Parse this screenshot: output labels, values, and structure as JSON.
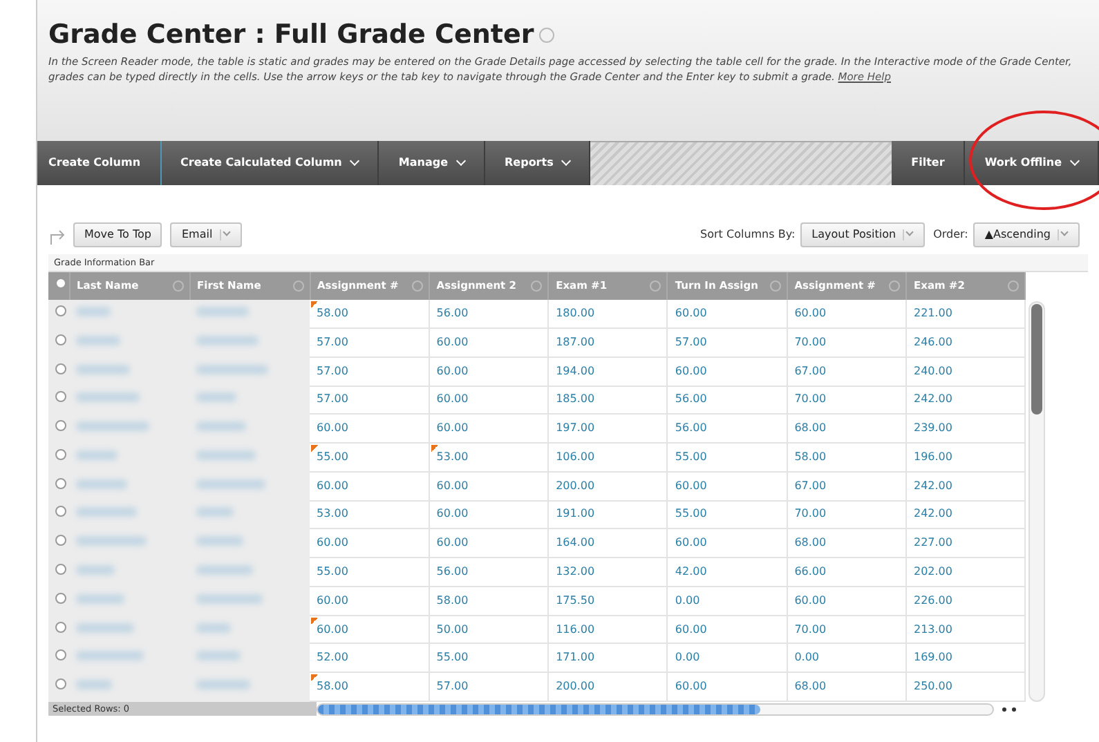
{
  "page": {
    "title": "Grade Center : Full Grade Center",
    "description": "In the Screen Reader mode, the table is static and grades may be entered on the Grade Details page accessed by selecting the table cell for the grade. In the Interactive mode of the Grade Center, grades can be typed directly in the cells. Use the arrow keys or the tab key to navigate through the Grade Center and the Enter key to submit a grade.",
    "help_link": "More Help"
  },
  "toolbar": {
    "items": [
      {
        "label": "Create Column",
        "dropdown": false
      },
      {
        "label": "Create Calculated Column",
        "dropdown": true
      },
      {
        "label": "Manage",
        "dropdown": true
      },
      {
        "label": "Reports",
        "dropdown": true
      }
    ],
    "right_items": [
      {
        "label": "Filter",
        "dropdown": false
      },
      {
        "label": "Work Offline",
        "dropdown": true
      }
    ]
  },
  "actions": [
    {
      "label": "Move To Top",
      "dropdown": false
    },
    {
      "label": "Email",
      "dropdown": true
    }
  ],
  "sort": {
    "label": "Sort Columns By:",
    "value": "Layout Position",
    "order_label": "Order:",
    "order_value": "▲Ascending"
  },
  "info_bar": "Grade Information Bar",
  "table": {
    "all_selected": false,
    "name_columns": [
      "Last Name",
      "First Name"
    ],
    "columns": [
      "Assignment #",
      "Assignment 2",
      "Exam #1",
      "Turn In Assign",
      "Assignment #",
      "Exam #2"
    ],
    "rows": [
      {
        "selected": false,
        "cells": [
          {
            "value": "58.00",
            "flagged": true
          },
          {
            "value": "56.00",
            "flagged": false
          },
          {
            "value": "180.00",
            "flagged": false
          },
          {
            "value": "60.00",
            "flagged": false
          },
          {
            "value": "60.00",
            "flagged": false
          },
          {
            "value": "221.00",
            "flagged": false
          }
        ]
      },
      {
        "selected": false,
        "cells": [
          {
            "value": "57.00",
            "flagged": false
          },
          {
            "value": "60.00",
            "flagged": false
          },
          {
            "value": "187.00",
            "flagged": false
          },
          {
            "value": "57.00",
            "flagged": false
          },
          {
            "value": "70.00",
            "flagged": false
          },
          {
            "value": "246.00",
            "flagged": false
          }
        ]
      },
      {
        "selected": false,
        "cells": [
          {
            "value": "57.00",
            "flagged": false
          },
          {
            "value": "60.00",
            "flagged": false
          },
          {
            "value": "194.00",
            "flagged": false
          },
          {
            "value": "60.00",
            "flagged": false
          },
          {
            "value": "67.00",
            "flagged": false
          },
          {
            "value": "240.00",
            "flagged": false
          }
        ]
      },
      {
        "selected": false,
        "cells": [
          {
            "value": "57.00",
            "flagged": false
          },
          {
            "value": "60.00",
            "flagged": false
          },
          {
            "value": "185.00",
            "flagged": false
          },
          {
            "value": "56.00",
            "flagged": false
          },
          {
            "value": "70.00",
            "flagged": false
          },
          {
            "value": "242.00",
            "flagged": false
          }
        ]
      },
      {
        "selected": false,
        "cells": [
          {
            "value": "60.00",
            "flagged": false
          },
          {
            "value": "60.00",
            "flagged": false
          },
          {
            "value": "197.00",
            "flagged": false
          },
          {
            "value": "56.00",
            "flagged": false
          },
          {
            "value": "68.00",
            "flagged": false
          },
          {
            "value": "239.00",
            "flagged": false
          }
        ]
      },
      {
        "selected": false,
        "cells": [
          {
            "value": "55.00",
            "flagged": true
          },
          {
            "value": "53.00",
            "flagged": true
          },
          {
            "value": "106.00",
            "flagged": false
          },
          {
            "value": "55.00",
            "flagged": false
          },
          {
            "value": "58.00",
            "flagged": false
          },
          {
            "value": "196.00",
            "flagged": false
          }
        ]
      },
      {
        "selected": false,
        "cells": [
          {
            "value": "60.00",
            "flagged": false
          },
          {
            "value": "60.00",
            "flagged": false
          },
          {
            "value": "200.00",
            "flagged": false
          },
          {
            "value": "60.00",
            "flagged": false
          },
          {
            "value": "67.00",
            "flagged": false
          },
          {
            "value": "242.00",
            "flagged": false
          }
        ]
      },
      {
        "selected": false,
        "cells": [
          {
            "value": "53.00",
            "flagged": false
          },
          {
            "value": "60.00",
            "flagged": false
          },
          {
            "value": "191.00",
            "flagged": false
          },
          {
            "value": "55.00",
            "flagged": false
          },
          {
            "value": "70.00",
            "flagged": false
          },
          {
            "value": "242.00",
            "flagged": false
          }
        ]
      },
      {
        "selected": false,
        "cells": [
          {
            "value": "60.00",
            "flagged": false
          },
          {
            "value": "60.00",
            "flagged": false
          },
          {
            "value": "164.00",
            "flagged": false
          },
          {
            "value": "60.00",
            "flagged": false
          },
          {
            "value": "68.00",
            "flagged": false
          },
          {
            "value": "227.00",
            "flagged": false
          }
        ]
      },
      {
        "selected": false,
        "cells": [
          {
            "value": "55.00",
            "flagged": false
          },
          {
            "value": "56.00",
            "flagged": false
          },
          {
            "value": "132.00",
            "flagged": false
          },
          {
            "value": "42.00",
            "flagged": false
          },
          {
            "value": "66.00",
            "flagged": false
          },
          {
            "value": "202.00",
            "flagged": false
          }
        ]
      },
      {
        "selected": false,
        "cells": [
          {
            "value": "60.00",
            "flagged": false
          },
          {
            "value": "58.00",
            "flagged": false
          },
          {
            "value": "175.50",
            "flagged": false
          },
          {
            "value": "0.00",
            "flagged": false
          },
          {
            "value": "60.00",
            "flagged": false
          },
          {
            "value": "226.00",
            "flagged": false
          }
        ]
      },
      {
        "selected": false,
        "cells": [
          {
            "value": "60.00",
            "flagged": true
          },
          {
            "value": "50.00",
            "flagged": false
          },
          {
            "value": "116.00",
            "flagged": false
          },
          {
            "value": "60.00",
            "flagged": false
          },
          {
            "value": "70.00",
            "flagged": false
          },
          {
            "value": "213.00",
            "flagged": false
          }
        ]
      },
      {
        "selected": false,
        "cells": [
          {
            "value": "52.00",
            "flagged": false
          },
          {
            "value": "55.00",
            "flagged": false
          },
          {
            "value": "171.00",
            "flagged": false
          },
          {
            "value": "0.00",
            "flagged": false
          },
          {
            "value": "0.00",
            "flagged": false
          },
          {
            "value": "169.00",
            "flagged": false
          }
        ]
      },
      {
        "selected": false,
        "cells": [
          {
            "value": "58.00",
            "flagged": true
          },
          {
            "value": "57.00",
            "flagged": false
          },
          {
            "value": "200.00",
            "flagged": false
          },
          {
            "value": "60.00",
            "flagged": false
          },
          {
            "value": "68.00",
            "flagged": false
          },
          {
            "value": "250.00",
            "flagged": false
          }
        ]
      }
    ]
  },
  "status_bar": "Selected Rows: 0"
}
